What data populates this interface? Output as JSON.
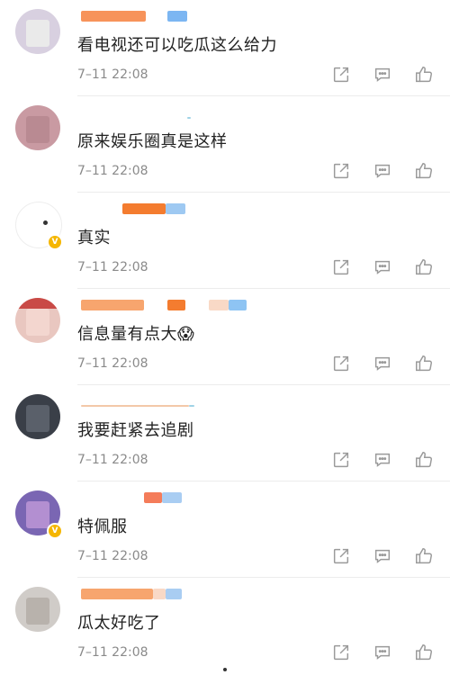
{
  "comments": [
    {
      "text": "看电视还可以吃瓜这么给力",
      "time": "7–11 22:08",
      "verified": false
    },
    {
      "text": "原来娱乐圈真是这样",
      "time": "7–11 22:08",
      "verified": false
    },
    {
      "text": "真实",
      "time": "7–11 22:08",
      "verified": true
    },
    {
      "text": "信息量有点大😱",
      "time": "7–11 22:08",
      "verified": false
    },
    {
      "text": "我要赶紧去追剧",
      "time": "7–11 22:08",
      "verified": false
    },
    {
      "text": "特佩服",
      "time": "7–11 22:08",
      "verified": true
    },
    {
      "text": "瓜太好吃了",
      "time": "7–11 22:08",
      "verified": false
    }
  ],
  "actions": [
    "share-icon",
    "comment-icon",
    "like-icon"
  ],
  "colors": {
    "text": "#222222",
    "muted": "#8a8a8a",
    "icon": "#9a9a9a",
    "divider": "#ececec"
  }
}
